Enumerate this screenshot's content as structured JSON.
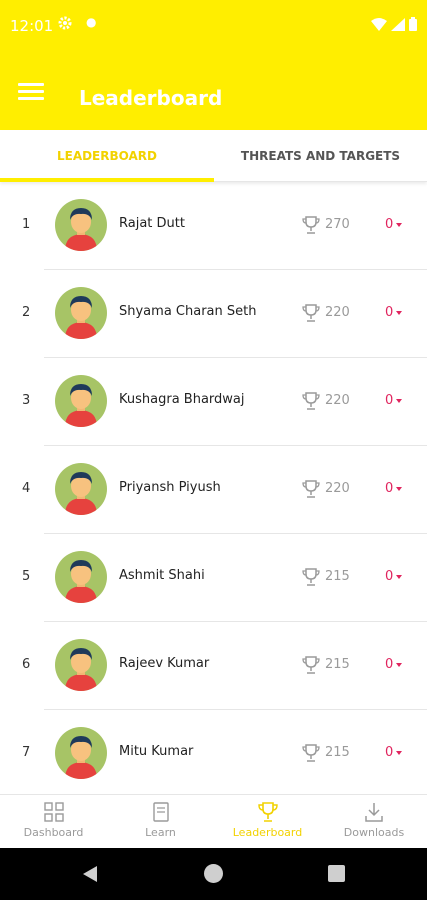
{
  "status": {
    "time": "12:01"
  },
  "appbar": {
    "title": "Leaderboard",
    "menu_icon": "hamburger-menu-icon"
  },
  "tabs": [
    {
      "label": "LEADERBOARD",
      "active": true
    },
    {
      "label": "THREATS AND TARGETS",
      "active": false
    }
  ],
  "leaderboard": [
    {
      "rank": "1",
      "name": "Rajat Dutt",
      "points": "270",
      "change": "0"
    },
    {
      "rank": "2",
      "name": "Shyama Charan Seth",
      "points": "220",
      "change": "0"
    },
    {
      "rank": "3",
      "name": "Kushagra Bhardwaj",
      "points": "220",
      "change": "0"
    },
    {
      "rank": "4",
      "name": "Priyansh Piyush",
      "points": "220",
      "change": "0"
    },
    {
      "rank": "5",
      "name": "Ashmit Shahi",
      "points": "215",
      "change": "0"
    },
    {
      "rank": "6",
      "name": "Rajeev Kumar",
      "points": "215",
      "change": "0"
    },
    {
      "rank": "7",
      "name": "Mitu Kumar",
      "points": "215",
      "change": "0"
    }
  ],
  "bottom_nav": [
    {
      "label": "Dashboard",
      "icon": "dashboard-icon",
      "active": false
    },
    {
      "label": "Learn",
      "icon": "book-icon",
      "active": false
    },
    {
      "label": "Leaderboard",
      "icon": "trophy-icon",
      "active": true
    },
    {
      "label": "Downloads",
      "icon": "download-icon",
      "active": false
    }
  ],
  "colors": {
    "brand": "#ffee00",
    "accent_text": "#f2d200",
    "negative": "#e0245e",
    "avatar_bg": "#a7c466"
  }
}
